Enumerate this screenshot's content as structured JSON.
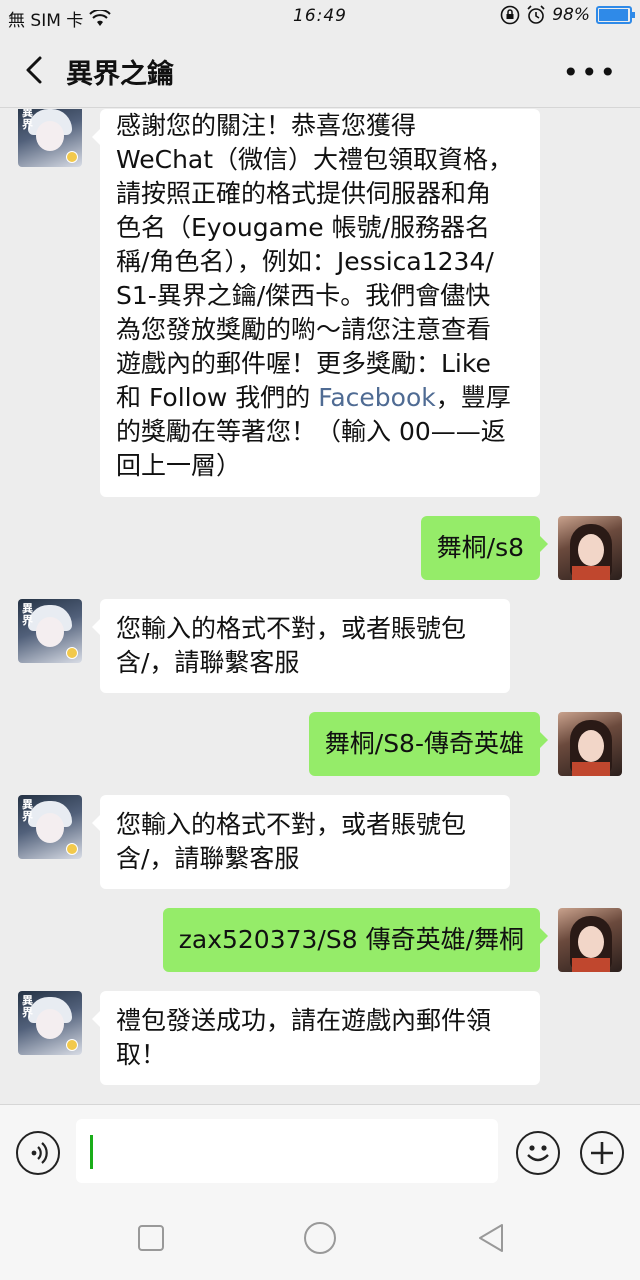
{
  "status_bar": {
    "carrier": "無 SIM 卡",
    "time": "16:49",
    "battery": "98%",
    "battery_level": 0.98
  },
  "header": {
    "title": "異界之鑰"
  },
  "messages": [
    {
      "from": "bot",
      "parts": [
        "感謝您的關注！恭喜您獲得 WeChat（微信）大禮包領取資格，請按照正確的格式提供伺服器和角色名（Eyougame帳號/服務器名稱/角色名），例如：Jessica1234/S1-異界之鑰/傑西卡。我們會儘快為您發放獎勵的喲～請您注意查看遊戲內的郵件喔！更多獎勵：Like 和 Follow 我們的",
        "Facebook",
        "，豐厚的獎勵在等著您！（輸入 00——返回上一層）"
      ],
      "lines": [
        "感謝您的關注！恭喜您獲得",
        "WeChat（微信）大禮包領取資格，",
        "請按照正確的格式提供伺服器和角",
        "色名（Eyougame 帳號/服務器名",
        "稱/角色名），例如：Jessica1234/",
        "S1-異界之鑰/傑西卡。我們會儘快",
        "為您發放獎勵的喲～請您注意查看",
        "遊戲內的郵件喔！更多獎勵：Like",
        "和 Follow 我們的 ",
        "Facebook",
        "，豐厚",
        "的獎勵在等著您！（輸入 00——返",
        "回上一層）"
      ]
    },
    {
      "from": "me",
      "text": "舞桐/s8"
    },
    {
      "from": "bot",
      "lines": [
        "您輸入的格式不對，或者賬號包",
        "含/，請聯繫客服"
      ]
    },
    {
      "from": "me",
      "text": "舞桐/S8-傳奇英雄"
    },
    {
      "from": "bot",
      "lines": [
        "您輸入的格式不對，或者賬號包",
        "含/，請聯繫客服"
      ]
    },
    {
      "from": "me",
      "text": "zax520373/S8 傳奇英雄/舞桐"
    },
    {
      "from": "bot",
      "lines": [
        "禮包發送成功，請在遊戲內郵件領",
        "取！"
      ]
    }
  ],
  "input": {
    "placeholder": ""
  },
  "colors": {
    "outgoing_bubble": "#95ec69",
    "incoming_bubble": "#ffffff",
    "link": "#4f6b93",
    "battery": "#2f8ae8"
  }
}
